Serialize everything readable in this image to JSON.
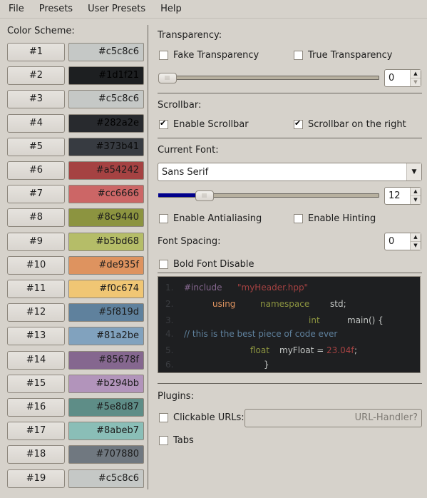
{
  "menu": [
    "File",
    "Presets",
    "User Presets",
    "Help"
  ],
  "color_scheme": {
    "title": "Color Scheme:",
    "items": [
      {
        "label": "#1",
        "hex": "#c5c8c6",
        "text_color": "#1c1c1c"
      },
      {
        "label": "#2",
        "hex": "#1d1f21",
        "text_color": "#000000"
      },
      {
        "label": "#3",
        "hex": "#c5c8c6",
        "text_color": "#1c1c1c"
      },
      {
        "label": "#4",
        "hex": "#282a2e",
        "text_color": "#000000"
      },
      {
        "label": "#5",
        "hex": "#373b41",
        "text_color": "#0a0a0a"
      },
      {
        "label": "#6",
        "hex": "#a54242",
        "text_color": "#1c1c1c"
      },
      {
        "label": "#7",
        "hex": "#cc6666",
        "text_color": "#1c1c1c"
      },
      {
        "label": "#8",
        "hex": "#8c9440",
        "text_color": "#1c1c1c"
      },
      {
        "label": "#9",
        "hex": "#b5bd68",
        "text_color": "#1c1c1c"
      },
      {
        "label": "#10",
        "hex": "#de935f",
        "text_color": "#1c1c1c"
      },
      {
        "label": "#11",
        "hex": "#f0c674",
        "text_color": "#1c1c1c"
      },
      {
        "label": "#12",
        "hex": "#5f819d",
        "text_color": "#1c1c1c"
      },
      {
        "label": "#13",
        "hex": "#81a2be",
        "text_color": "#1c1c1c"
      },
      {
        "label": "#14",
        "hex": "#85678f",
        "text_color": "#1c1c1c"
      },
      {
        "label": "#15",
        "hex": "#b294bb",
        "text_color": "#1c1c1c"
      },
      {
        "label": "#16",
        "hex": "#5e8d87",
        "text_color": "#1c1c1c"
      },
      {
        "label": "#17",
        "hex": "#8abeb7",
        "text_color": "#1c1c1c"
      },
      {
        "label": "#18",
        "hex": "#707880",
        "text_color": "#1c1c1c"
      },
      {
        "label": "#19",
        "hex": "#c5c8c6",
        "text_color": "#1c1c1c"
      }
    ]
  },
  "transparency": {
    "title": "Transparency:",
    "fake": {
      "label": "Fake Transparency",
      "checked": false
    },
    "true_t": {
      "label": "True Transparency",
      "checked": false
    },
    "value": "0",
    "slider_fraction": 0.0
  },
  "scrollbar": {
    "title": "Scrollbar:",
    "enable": {
      "label": "Enable Scrollbar",
      "checked": true
    },
    "right": {
      "label": "Scrollbar on the right",
      "checked": true
    }
  },
  "font": {
    "title": "Current Font:",
    "family": "Sans Serif",
    "size": "12",
    "slider_fraction": 0.15,
    "slider_fill_color": "#00008b",
    "antialiasing": {
      "label": "Enable Antialiasing",
      "checked": false
    },
    "hinting": {
      "label": "Enable Hinting",
      "checked": false
    },
    "spacing_label": "Font Spacing:",
    "spacing": "0",
    "bold_disable": {
      "label": "Bold Font Disable",
      "checked": false
    }
  },
  "code_preview": {
    "line_numbers": [
      "1.",
      "2.",
      "3.",
      "4.",
      "5.",
      "6."
    ],
    "tokens": [
      {
        "text": "#include",
        "color": "#85678f",
        "line": 0
      },
      {
        "text": "\"myHeader.hpp\"",
        "color": "#a54242",
        "line": 0
      },
      {
        "text": "using",
        "color": "#de935f",
        "line": 1
      },
      {
        "text": "namespace",
        "color": "#8c9440",
        "line": 1
      },
      {
        "text": "std;",
        "color": "#c5c8c6",
        "line": 1
      },
      {
        "text": "int",
        "color": "#8c9440",
        "line": 2
      },
      {
        "text": "main() {",
        "color": "#c5c8c6",
        "line": 2
      },
      {
        "text": "// this is the best piece of code ever",
        "color": "#5f819d",
        "line": 3
      },
      {
        "text": "float",
        "color": "#8c9440",
        "line": 4
      },
      {
        "text": "myFloat =",
        "color": "#c5c8c6",
        "line": 4
      },
      {
        "text": "23.04f",
        "color": "#a54242",
        "line": 4
      },
      {
        "text": ";",
        "color": "#c5c8c6",
        "line": 4
      },
      {
        "text": "}",
        "color": "#c5c8c6",
        "line": 5
      }
    ]
  },
  "plugins": {
    "title": "Plugins:",
    "clickable_urls": {
      "label": "Clickable URLs:",
      "checked": false
    },
    "url_handler_placeholder": "URL-Handler?",
    "tabs": {
      "label": "Tabs",
      "checked": false
    }
  }
}
